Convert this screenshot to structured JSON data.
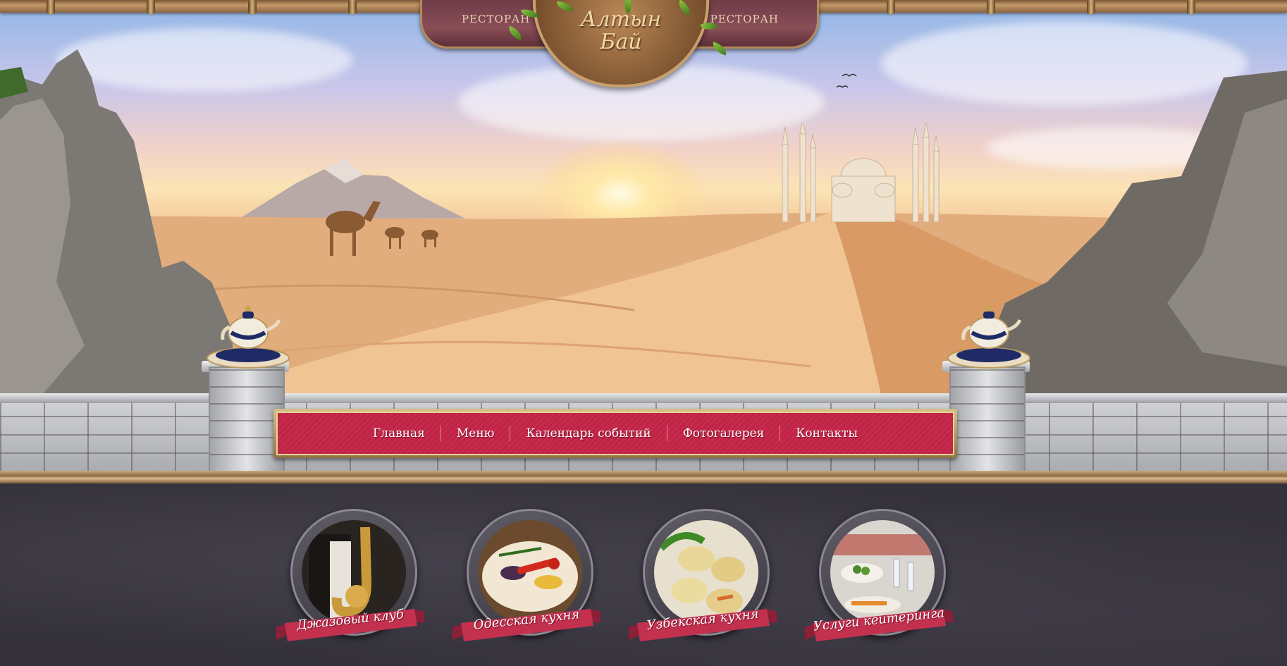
{
  "header": {
    "label_left": "РЕСТОРАН",
    "label_right": "РЕСТОРАН",
    "logo_line1": "Алтын",
    "logo_line2": "Бай"
  },
  "nav": {
    "items": [
      "Главная",
      "Меню",
      "Календарь событий",
      "Фотогалерея",
      "Контакты"
    ]
  },
  "features": [
    {
      "label": "Джазовый клуб",
      "icon": "saxophone-photo"
    },
    {
      "label": "Одесская кухня",
      "icon": "grilled-vegetables-photo"
    },
    {
      "label": "Узбекская кухня",
      "icon": "dumplings-photo"
    },
    {
      "label": "Услуги кейтеринга",
      "icon": "catering-table-photo"
    }
  ],
  "colors": {
    "nav_red": "#c72a4c",
    "ribbon_red": "#c3314f",
    "gold_frame": "#d6c08a",
    "stone_gray": "#bfc0c4",
    "bottom_dark": "#34313a"
  }
}
